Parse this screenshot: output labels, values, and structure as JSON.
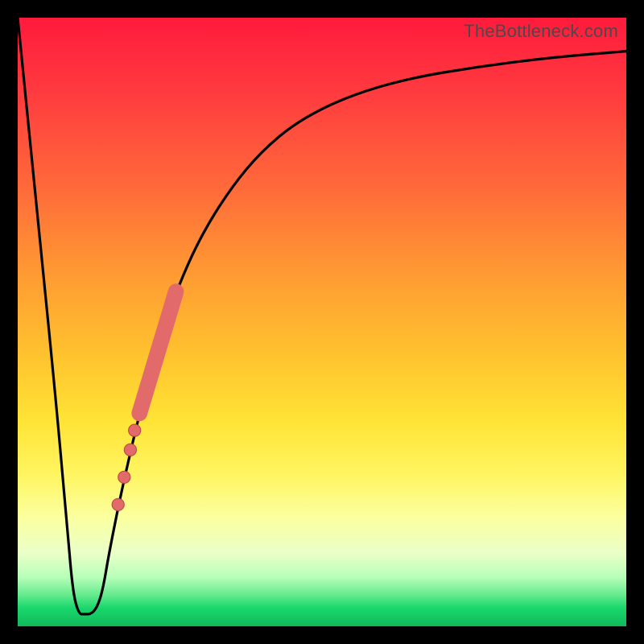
{
  "watermark": "TheBottleneck.com",
  "colors": {
    "frame": "#000000",
    "curve": "#000000",
    "marker_fill": "#e26a6a",
    "marker_stroke": "#b94040"
  },
  "chart_data": {
    "type": "line",
    "title": "",
    "xlabel": "",
    "ylabel": "",
    "xlim": [
      0,
      100
    ],
    "ylim": [
      0,
      100
    ],
    "series": [
      {
        "name": "bottleneck-curve",
        "x": [
          0,
          3,
          6,
          8,
          9,
          10,
          11,
          12,
          13,
          14,
          15,
          17,
          20,
          23,
          26,
          30,
          35,
          40,
          46,
          54,
          64,
          76,
          88,
          100
        ],
        "y": [
          100,
          70,
          40,
          18,
          6,
          2,
          2,
          2,
          3,
          6,
          12,
          22,
          35,
          46,
          55,
          64,
          72,
          78,
          83,
          87,
          90,
          92,
          93.5,
          94.5
        ]
      }
    ],
    "markers": {
      "name": "highlighted-range",
      "shape": "circle",
      "along_series": "bottleneck-curve",
      "points": [
        {
          "x": 16.5,
          "y": 20.0,
          "r": 1.0
        },
        {
          "x": 17.5,
          "y": 24.5,
          "r": 1.0
        },
        {
          "x": 18.5,
          "y": 29.0,
          "r": 1.0
        },
        {
          "x": 19.2,
          "y": 32.2,
          "r": 1.0
        }
      ],
      "thick_segment": {
        "x0": 20.0,
        "y0": 35.0,
        "x1": 26.0,
        "y1": 55.0,
        "width": 2.6
      }
    }
  }
}
